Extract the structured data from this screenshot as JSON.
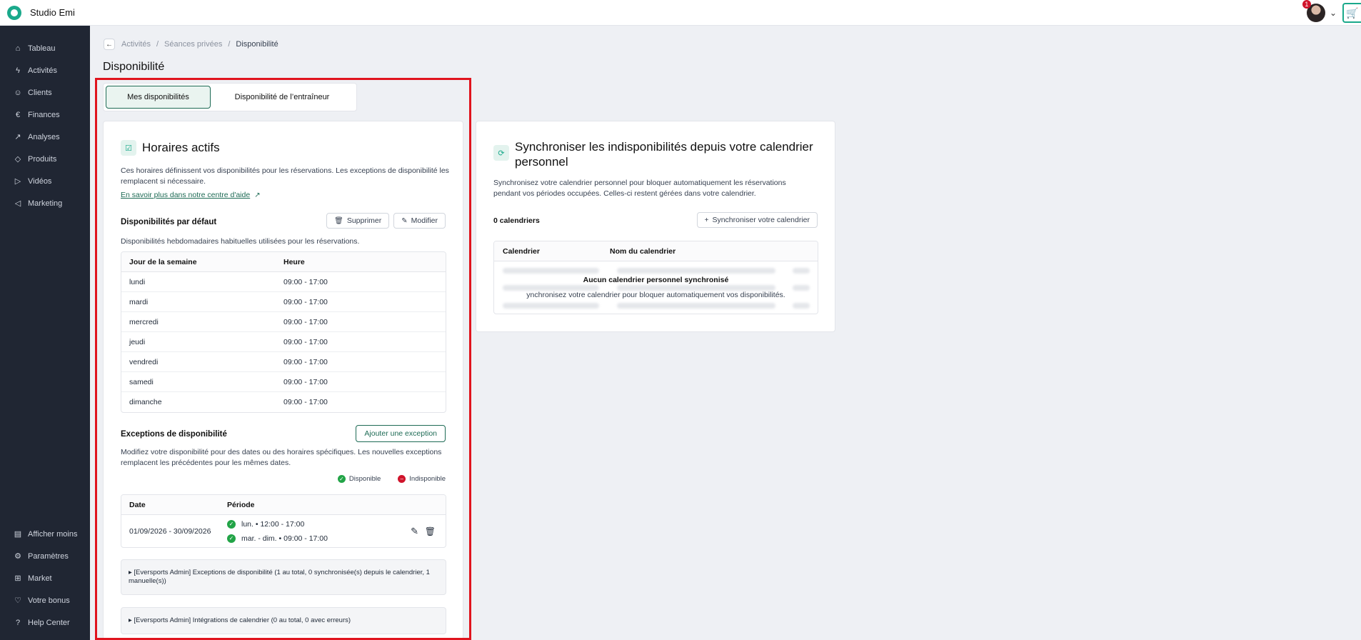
{
  "app": {
    "brand": "Studio Emi",
    "notification_count": "1"
  },
  "sidebar": {
    "items": [
      {
        "label": "Tableau",
        "icon": "home-icon"
      },
      {
        "label": "Activités",
        "icon": "lightning-icon"
      },
      {
        "label": "Clients",
        "icon": "user-icon"
      },
      {
        "label": "Finances",
        "icon": "euro-icon"
      },
      {
        "label": "Analyses",
        "icon": "chart-icon"
      },
      {
        "label": "Produits",
        "icon": "box-icon"
      },
      {
        "label": "Vidéos",
        "icon": "play-icon"
      },
      {
        "label": "Marketing",
        "icon": "megaphone-icon"
      }
    ],
    "bottom_items": [
      {
        "label": "Afficher moins",
        "icon": "collapse-icon"
      },
      {
        "label": "Paramètres",
        "icon": "gear-icon"
      },
      {
        "label": "Market",
        "icon": "plus-box-icon"
      },
      {
        "label": "Votre bonus",
        "icon": "heart-icon"
      },
      {
        "label": "Help Center",
        "icon": "help-icon"
      }
    ]
  },
  "breadcrumb": {
    "items": [
      "Activités",
      "Séances privées"
    ],
    "current": "Disponibilité"
  },
  "page_title": "Disponibilité",
  "tabs": [
    {
      "label": "Mes disponibilités",
      "active": true
    },
    {
      "label": "Disponibilité de l’entraîneur",
      "active": false
    }
  ],
  "active_hours": {
    "title": "Horaires actifs",
    "description": "Ces horaires définissent vos disponibilités pour les réservations. Les exceptions de disponibilité les remplacent si nécessaire.",
    "help_link": "En savoir plus dans notre centre d'aide",
    "default": {
      "title": "Disponibilités par défaut",
      "delete_label": "Supprimer",
      "edit_label": "Modifier",
      "description": "Disponibilités hebdomadaires habituelles utilisées pour les réservations.",
      "columns": [
        "Jour de la semaine",
        "Heure"
      ],
      "rows": [
        {
          "day": "lundi",
          "hours": "09:00 - 17:00"
        },
        {
          "day": "mardi",
          "hours": "09:00 - 17:00"
        },
        {
          "day": "mercredi",
          "hours": "09:00 - 17:00"
        },
        {
          "day": "jeudi",
          "hours": "09:00 - 17:00"
        },
        {
          "day": "vendredi",
          "hours": "09:00 - 17:00"
        },
        {
          "day": "samedi",
          "hours": "09:00 - 17:00"
        },
        {
          "day": "dimanche",
          "hours": "09:00 - 17:00"
        }
      ]
    },
    "exceptions": {
      "title": "Exceptions de disponibilité",
      "add_label": "Ajouter une exception",
      "description": "Modifiez votre disponibilité pour des dates ou des horaires spécifiques. Les nouvelles exceptions remplacent les précédentes pour les mêmes dates.",
      "legend_available": "Disponible",
      "legend_unavailable": "Indisponible",
      "columns": [
        "Date",
        "Période"
      ],
      "rows": [
        {
          "date": "01/09/2026 - 30/09/2026",
          "periods": [
            "lun. • 12:00 - 17:00",
            "mar. - dim. • 09:00 - 17:00"
          ]
        }
      ]
    },
    "admin_exceptions": "▸ [Eversports Admin] Exceptions de disponibilité (1 au total, 0 synchronisée(s) depuis le calendrier, 1 manuelle(s))",
    "admin_integrations": "▸ [Eversports Admin] Intégrations de calendrier (0 au total, 0 avec erreurs)"
  },
  "sync": {
    "title": "Synchroniser les indisponibilités depuis votre calendrier personnel",
    "description": "Synchronisez votre calendrier personnel pour bloquer automatiquement les réservations pendant vos périodes occupées. Celles-ci restent gérées dans votre calendrier.",
    "count_label": "0 calendriers",
    "sync_button": "Synchroniser votre calendrier",
    "columns": [
      "Calendrier",
      "Nom du calendrier"
    ],
    "empty_title": "Aucun calendrier personnel synchronisé",
    "empty_text": "ynchronisez votre calendrier pour bloquer automatiquement vos disponibilités."
  },
  "colors": {
    "accent": "#1e6b55",
    "sidebar_bg": "#202633",
    "highlight": "#e0141e",
    "available": "#22a447",
    "unavailable": "#d0142b"
  }
}
